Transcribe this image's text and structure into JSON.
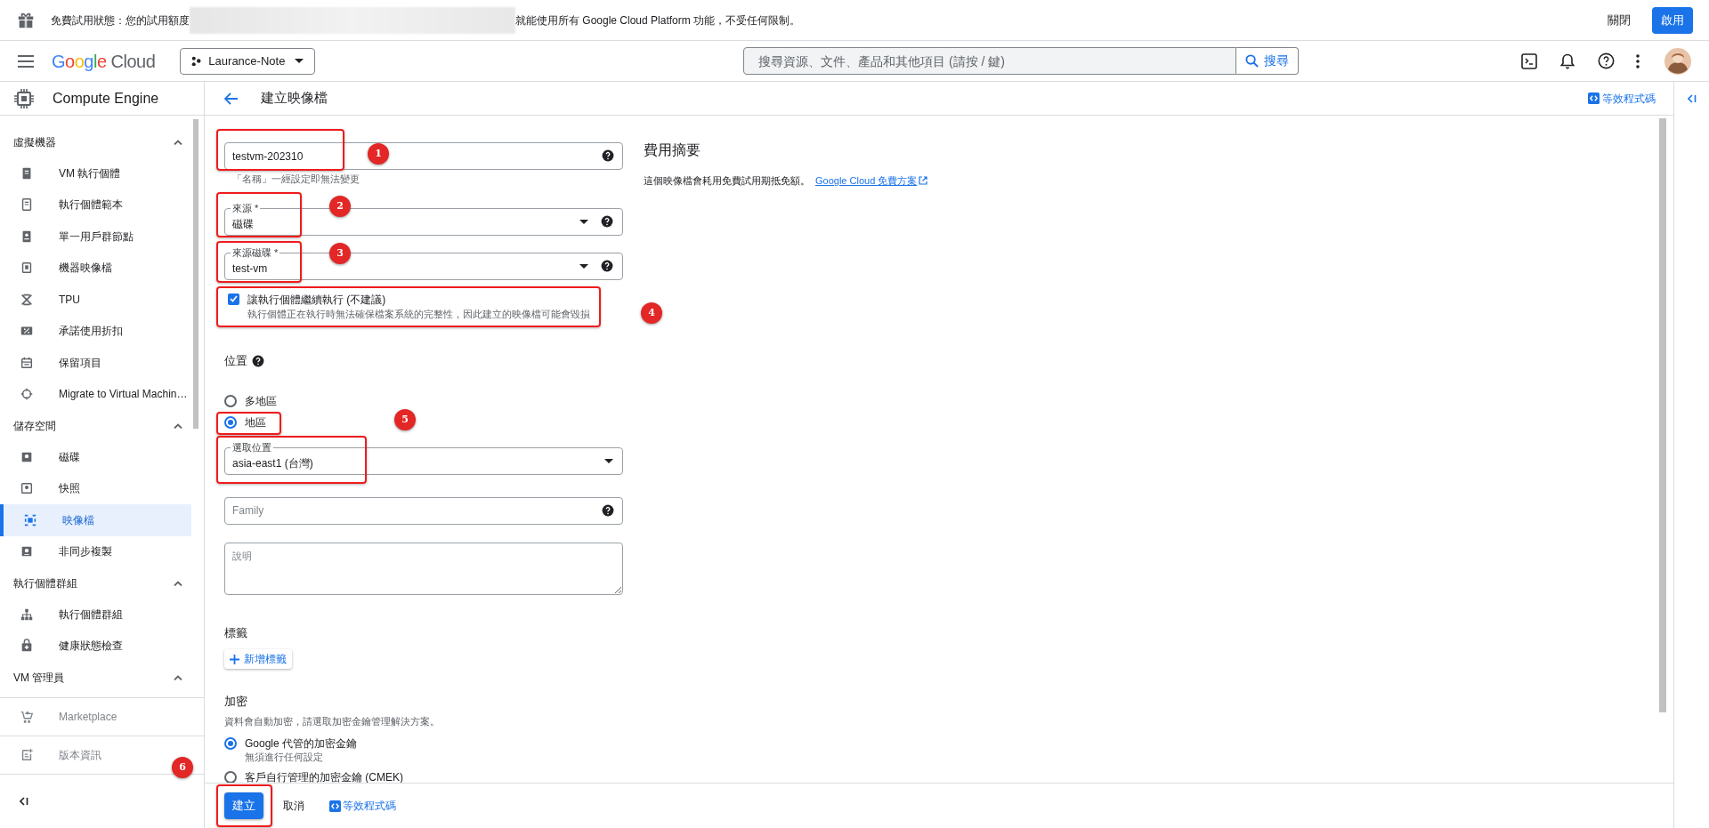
{
  "banner": {
    "message_start": "免費試用狀態：您的試用額度",
    "message_end": "就能使用所有 Google Cloud Platform 功能，不受任何限制。",
    "dismiss": "關閉",
    "activate": "啟用"
  },
  "header": {
    "logo": "Google Cloud",
    "project": "Laurance-Note",
    "search_placeholder": "搜尋資源、文件、產品和其他項目 (請按 / 鍵)",
    "search_button": "搜尋"
  },
  "product": "Compute Engine",
  "page": {
    "title": "建立映像檔",
    "code_link": "等效程式碼"
  },
  "sidebar": {
    "sections": [
      {
        "title": "虛擬機器",
        "expanded": true,
        "items": [
          {
            "label": "VM 執行個體",
            "selected": false
          },
          {
            "label": "執行個體範本",
            "selected": false
          },
          {
            "label": "單一用戶群節點",
            "selected": false
          },
          {
            "label": "機器映像檔",
            "selected": false
          },
          {
            "label": "TPU",
            "selected": false
          },
          {
            "label": "承諾使用折扣",
            "selected": false
          },
          {
            "label": "保留項目",
            "selected": false
          },
          {
            "label": "Migrate to Virtual Machin…",
            "selected": false
          }
        ]
      },
      {
        "title": "儲存空間",
        "expanded": true,
        "items": [
          {
            "label": "磁碟",
            "selected": false
          },
          {
            "label": "快照",
            "selected": false
          },
          {
            "label": "映像檔",
            "selected": true
          },
          {
            "label": "非同步複製",
            "selected": false
          }
        ]
      },
      {
        "title": "執行個體群組",
        "expanded": true,
        "items": [
          {
            "label": "執行個體群組",
            "selected": false
          },
          {
            "label": "健康狀態檢查",
            "selected": false
          }
        ]
      },
      {
        "title": "VM 管理員",
        "expanded": true
      }
    ],
    "footer": [
      {
        "label": "Marketplace"
      },
      {
        "label": "版本資訊"
      }
    ]
  },
  "form": {
    "name": {
      "value": "testvm-202310",
      "hint": "「名稱」一經設定即無法變更"
    },
    "source": {
      "label": "來源 *",
      "value": "磁碟"
    },
    "source_disk": {
      "label": "來源磁碟 *",
      "value": "test-vm"
    },
    "keep_running": {
      "checked": true,
      "label": "讓執行個體繼續執行 (不建議)",
      "description": "執行個體正在執行時無法確保檔案系統的完整性，因此建立的映像檔可能會毀損"
    },
    "location": {
      "title": "位置",
      "options": [
        {
          "label": "多地區",
          "selected": false
        },
        {
          "label": "地區",
          "selected": true
        }
      ],
      "select": {
        "label": "選取位置",
        "value": "asia-east1 (台灣)"
      }
    },
    "family": {
      "placeholder": "Family"
    },
    "description": {
      "placeholder": "說明"
    },
    "labels": {
      "title": "標籤",
      "add_button": "新增標籤"
    },
    "encryption": {
      "title": "加密",
      "description": "資料會自動加密，請選取加密金鑰管理解決方案。",
      "options": [
        {
          "label": "Google 代管的加密金鑰",
          "sublabel": "無須進行任何設定",
          "selected": true
        },
        {
          "label": "客戶自行管理的加密金鑰 (CMEK)",
          "selected": false
        }
      ]
    }
  },
  "cost_summary": {
    "title": "費用摘要",
    "text": "這個映像檔會耗用免費試用期抵免額。",
    "link": "Google Cloud 免費方案"
  },
  "footer": {
    "create": "建立",
    "cancel": "取消",
    "code_link": "等效程式碼"
  },
  "annotations": [
    "1",
    "2",
    "3",
    "4",
    "5",
    "6"
  ]
}
